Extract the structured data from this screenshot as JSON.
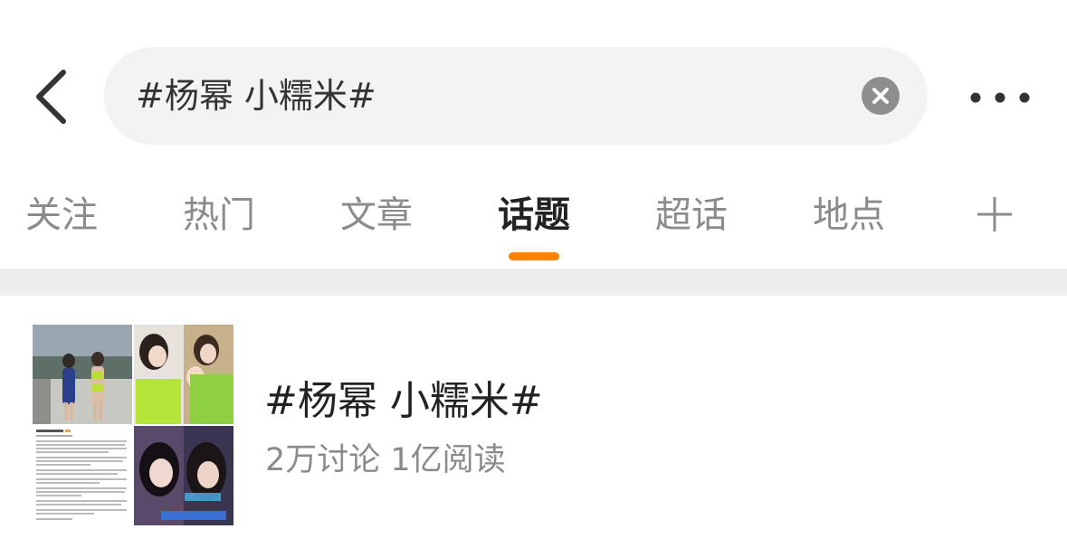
{
  "search": {
    "query": "#杨幂 小糯米#"
  },
  "tabs": [
    {
      "label": "关注"
    },
    {
      "label": "热门"
    },
    {
      "label": "文章"
    },
    {
      "label": "话题"
    },
    {
      "label": "超话"
    },
    {
      "label": "地点"
    }
  ],
  "active_tab": "话题",
  "result": {
    "title": "#杨幂 小糯米#",
    "stats": "2万讨论 1亿阅读"
  },
  "colors": {
    "accent": "#ff8200",
    "search_bg": "#f3f3f3",
    "divider": "#eeeeee",
    "muted_text": "#8b8b8b"
  },
  "icons": {
    "back": "back-arrow-icon",
    "clear": "clear-icon",
    "more": "more-dots-icon",
    "add": "plus-icon"
  }
}
